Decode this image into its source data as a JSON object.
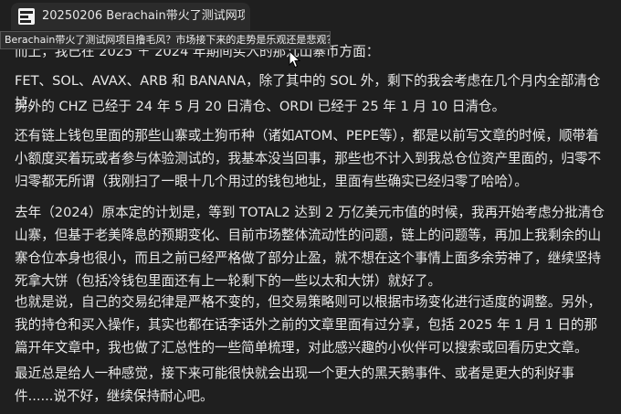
{
  "tab": {
    "title": "20250206 Berachain带火了测试网项..."
  },
  "tooltip": {
    "text": "Berachain带火了测试网项目撸毛风？市场接下来的走势是乐观还是悲观？"
  },
  "article": {
    "partial_line": "而上，我已在 2025 ＋ 2024 年期间买入的那几山寨币方面：",
    "paragraphs": [
      "FET、SOL、AVAX、ARB 和 BANANA，除了其中的 SOL 外，剩下的我会考虑在几个月内全部清仓掉。",
      "另外的 CHZ 已经于 24 年 5 月 20 日清仓、ORDI 已经于 25 年 1 月 10 日清仓。",
      "还有链上钱包里面的那些山寨或土狗币种（诸如ATOM、PEPE等），都是以前写文章的时候，顺带着小额度买着玩或者参与体验测试的，我基本没当回事，那些也不计入到我总仓位资产里面的，归零不归零都无所谓（我刚扫了一眼十几个用过的钱包地址，里面有些确实已经归零了哈哈）。",
      "去年（2024）原本定的计划是，等到 TOTAL2 达到 2 万亿美元市值的时候，我再开始考虑分批清仓山寨，但基于老美降息的预期变化、目前市场整体流动性的问题，链上的问题等，再加上我剩余的山寨仓位本身也很小，而且之前已经严格做了部分止盈，就不想在这个事情上面多余劳神了，继续坚持死拿大饼（包括冷钱包里面还有上一轮剩下的一些以太和大饼）就好了。",
      "也就是说，自己的交易纪律是严格不变的，但交易策略则可以根据市场变化进行适度的调整。另外，我的持仓和买入操作，其实也都在话李话外之前的文章里面有过分享，包括 2025 年 1 月 1 日的那篇开年文章中，我也做了汇总性的一些简单梳理，对此感兴趣的小伙伴可以搜索或回看历史文章。",
      "最近总是给人一种感觉，接下来可能很快就会出现一个更大的黑天鹅事件、或者是更大的利好事件......说不好，继续保持耐心吧。"
    ]
  }
}
